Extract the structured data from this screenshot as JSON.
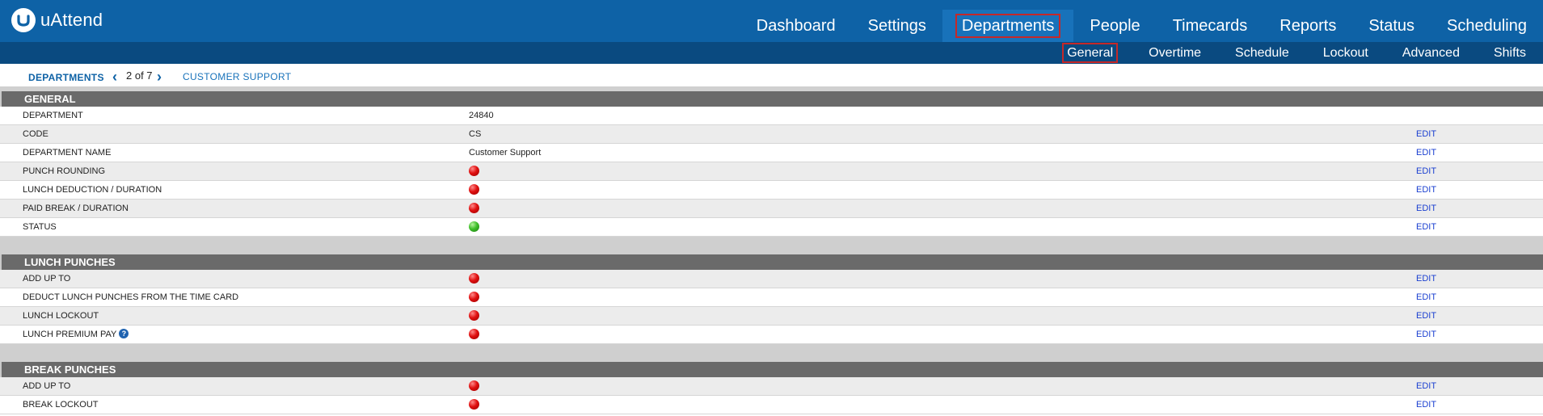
{
  "brand": {
    "name": "uAttend",
    "logo_icon": "u-logo-icon"
  },
  "main_nav": {
    "items": [
      {
        "label": "Dashboard",
        "active": false
      },
      {
        "label": "Settings",
        "active": false
      },
      {
        "label": "Departments",
        "active": true
      },
      {
        "label": "People",
        "active": false
      },
      {
        "label": "Timecards",
        "active": false
      },
      {
        "label": "Reports",
        "active": false
      },
      {
        "label": "Status",
        "active": false
      },
      {
        "label": "Scheduling",
        "active": false
      }
    ]
  },
  "sub_nav": {
    "items": [
      {
        "label": "General",
        "active": true
      },
      {
        "label": "Overtime",
        "active": false
      },
      {
        "label": "Schedule",
        "active": false
      },
      {
        "label": "Lockout",
        "active": false
      },
      {
        "label": "Advanced",
        "active": false
      },
      {
        "label": "Shifts",
        "active": false
      }
    ]
  },
  "breadcrumb": {
    "section": "DEPARTMENTS",
    "pager": "2 of 7",
    "current": "CUSTOMER SUPPORT"
  },
  "sections": [
    {
      "title": "GENERAL",
      "rows": [
        {
          "label": "DEPARTMENT",
          "value": "24840",
          "edit": ""
        },
        {
          "label": "CODE",
          "value": "CS",
          "edit": "EDIT"
        },
        {
          "label": "DEPARTMENT NAME",
          "value": "Customer Support",
          "edit": "EDIT"
        },
        {
          "label": "PUNCH ROUNDING",
          "status": "red",
          "edit": "EDIT"
        },
        {
          "label": "LUNCH DEDUCTION / DURATION",
          "status": "red",
          "edit": "EDIT"
        },
        {
          "label": "PAID BREAK / DURATION",
          "status": "red",
          "edit": "EDIT"
        },
        {
          "label": "STATUS",
          "status": "green",
          "edit": "EDIT"
        }
      ]
    },
    {
      "title": "LUNCH PUNCHES",
      "rows": [
        {
          "label": "ADD UP TO",
          "status": "red",
          "edit": "EDIT"
        },
        {
          "label": "DEDUCT LUNCH PUNCHES FROM THE TIME CARD",
          "status": "red",
          "edit": "EDIT"
        },
        {
          "label": "LUNCH LOCKOUT",
          "status": "red",
          "edit": "EDIT"
        },
        {
          "label": "LUNCH PREMIUM PAY",
          "status": "red",
          "edit": "EDIT",
          "help": "?"
        }
      ]
    },
    {
      "title": "BREAK PUNCHES",
      "rows": [
        {
          "label": "ADD UP TO",
          "status": "red",
          "edit": "EDIT"
        },
        {
          "label": "BREAK LOCKOUT",
          "status": "red",
          "edit": "EDIT"
        }
      ]
    }
  ]
}
